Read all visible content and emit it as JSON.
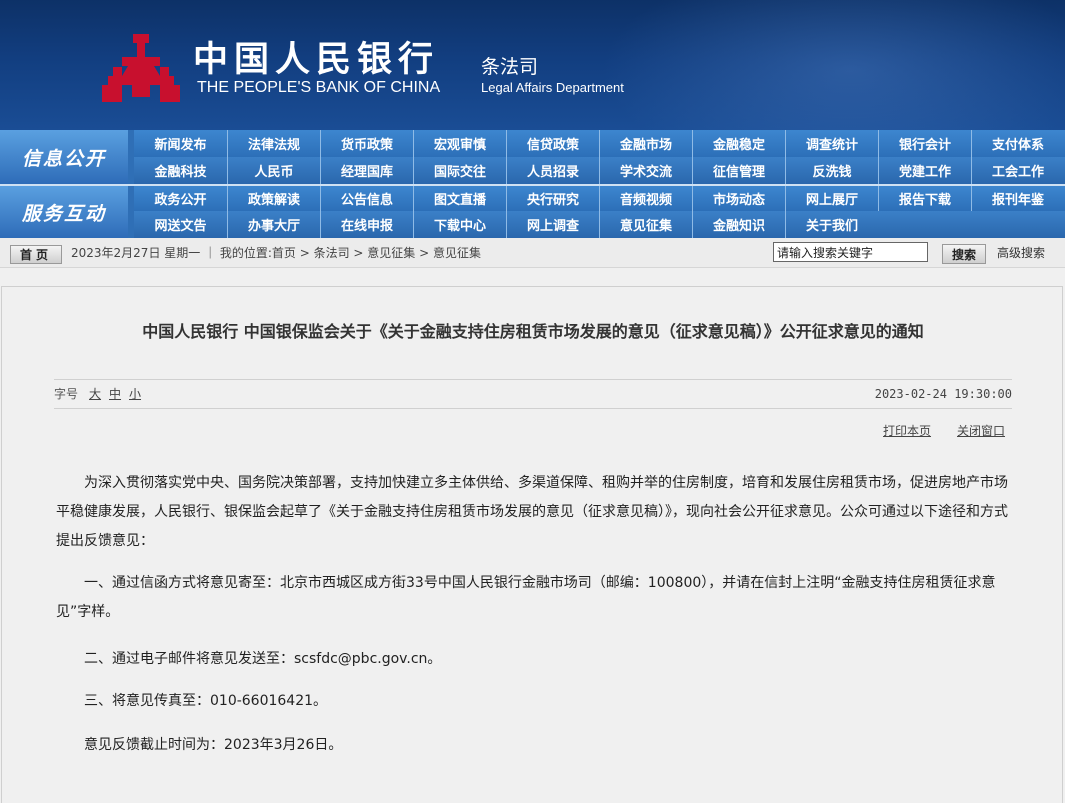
{
  "header": {
    "bank_name_cn": "中国人民银行",
    "bank_name_en": "THE PEOPLE'S BANK OF CHINA",
    "dept_cn": "条法司",
    "dept_en": "Legal Affairs Department",
    "colors": {
      "banner": "#123e80",
      "logo": "#c8102e",
      "nav": "#2f6fb6"
    }
  },
  "nav": {
    "sections": [
      {
        "label": "信息公开",
        "rows": [
          [
            "新闻发布",
            "法律法规",
            "货币政策",
            "宏观审慎",
            "信贷政策",
            "金融市场",
            "金融稳定",
            "调查统计",
            "银行会计",
            "支付体系"
          ],
          [
            "金融科技",
            "人民币",
            "经理国库",
            "国际交往",
            "人员招录",
            "学术交流",
            "征信管理",
            "反洗钱",
            "党建工作",
            "工会工作"
          ]
        ]
      },
      {
        "label": "服务互动",
        "rows": [
          [
            "政务公开",
            "政策解读",
            "公告信息",
            "图文直播",
            "央行研究",
            "音频视频",
            "市场动态",
            "网上展厅",
            "报告下载",
            "报刊年鉴"
          ],
          [
            "网送文告",
            "办事大厅",
            "在线申报",
            "下载中心",
            "网上调查",
            "意见征集",
            "金融知识",
            "关于我们"
          ]
        ]
      }
    ]
  },
  "infobar": {
    "home_label": "首页",
    "date_text": "2023年2月27日 星期一 ｜ 我的位置:首页 > 条法司 > 意见征集 > 意见征集",
    "search_placeholder": "请输入搜索关键字",
    "search_label": "搜索",
    "advanced_label": "高级搜索"
  },
  "article": {
    "title": "中国人民银行 中国银保监会关于《关于金融支持住房租赁市场发展的意见（征求意见稿）》公开征求意见的通知",
    "font_size_label": "字号",
    "font_sizes": [
      "大",
      "中",
      "小"
    ],
    "date": "2023-02-24 19:30:00",
    "print_label": "打印本页",
    "close_label": "关闭窗口",
    "paragraphs": [
      "为深入贯彻落实党中央、国务院决策部署，支持加快建立多主体供给、多渠道保障、租购并举的住房制度，培育和发展住房租赁市场，促进房地产市场平稳健康发展，人民银行、银保监会起草了《关于金融支持住房租赁市场发展的意见（征求意见稿）》，现向社会公开征求意见。公众可通过以下途径和方式提出反馈意见：",
      "一、通过信函方式将意见寄至：北京市西城区成方街33号中国人民银行金融市场司（邮编：100800），并请在信封上注明“金融支持住房租赁征求意见”字样。",
      "二、通过电子邮件将意见发送至：scsfdc@pbc.gov.cn。",
      "三、将意见传真至：010-66016421。",
      "意见反馈截止时间为：2023年3月26日。"
    ]
  }
}
